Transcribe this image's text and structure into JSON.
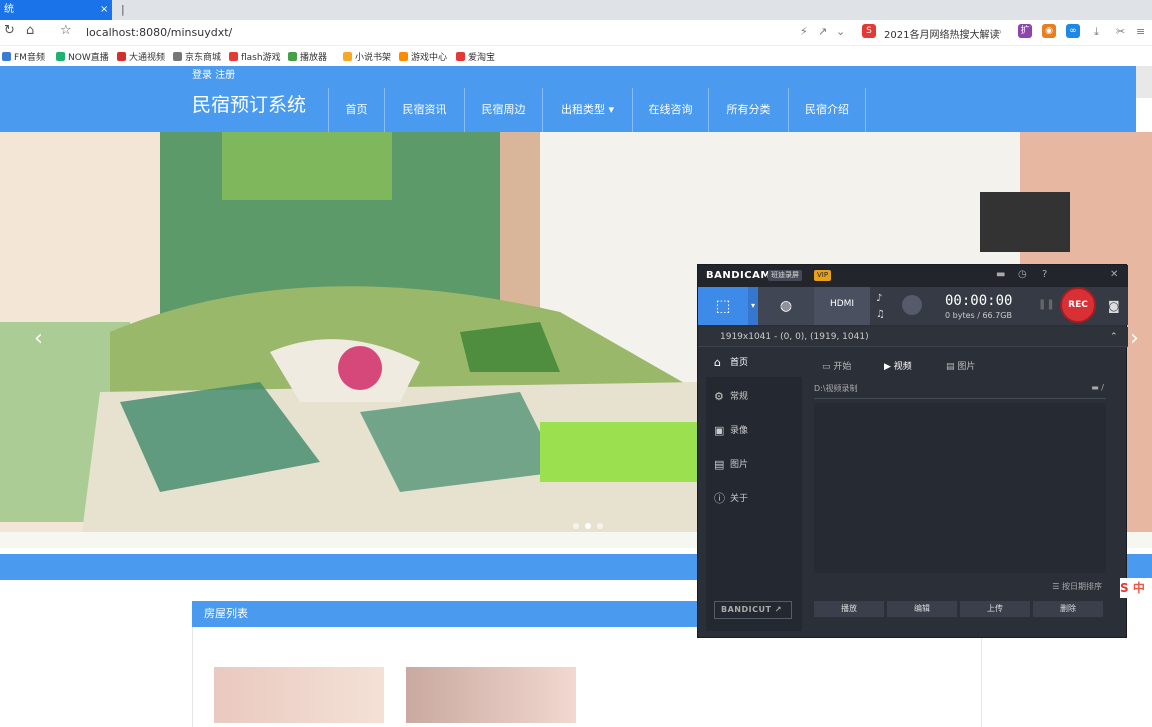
{
  "browser": {
    "tab_title": "统",
    "tab_close": "×",
    "new_tab": "|",
    "url": "localhost:8080/minsuydxt/",
    "news_text": "2021各月网络热搜大解读",
    "bookmarks": [
      {
        "label": "FM音频",
        "color": "#3b7bd8"
      },
      {
        "label": "NOW直播",
        "color": "#1bb36f"
      },
      {
        "label": "大通视频",
        "color": "#d32f2f"
      },
      {
        "label": "京东商城",
        "color": "#777777"
      },
      {
        "label": "flash游戏",
        "color": "#e53935"
      },
      {
        "label": "播放器",
        "color": "#43a047"
      },
      {
        "label": "小说书架",
        "color": "#f9a825"
      },
      {
        "label": "游戏中心",
        "color": "#fb8c00"
      },
      {
        "label": "爱淘宝",
        "color": "#e53935"
      }
    ]
  },
  "site": {
    "login": "登录 注册",
    "title": "民宿预订系统",
    "nav": [
      "首页",
      "民宿资讯",
      "民宿周边",
      "出租类型",
      "在线咨询",
      "所有分类",
      "民宿介绍"
    ],
    "dropdown_caret": "▾",
    "list_header": "房屋列表",
    "colors": {
      "primary": "#4a9af0"
    }
  },
  "bandicam": {
    "logo": "BANDICAM",
    "edition_tag": "班迪录屏",
    "vip": "VIP",
    "hdmi": "HDMI",
    "timer": "00:00:00",
    "size": "0 bytes / 66.7GB",
    "rec": "REC",
    "region": "1919x1041 - (0, 0), (1919, 1041)",
    "sidebar": [
      "首页",
      "常规",
      "录像",
      "图片",
      "关于"
    ],
    "subtabs": [
      "开始",
      "视频",
      "图片"
    ],
    "path": "D:\\视频录制",
    "sort": "按日期排序",
    "buttons": [
      "播放",
      "编辑",
      "上传",
      "删除"
    ],
    "bandicut": "BANDICUT ↗"
  }
}
